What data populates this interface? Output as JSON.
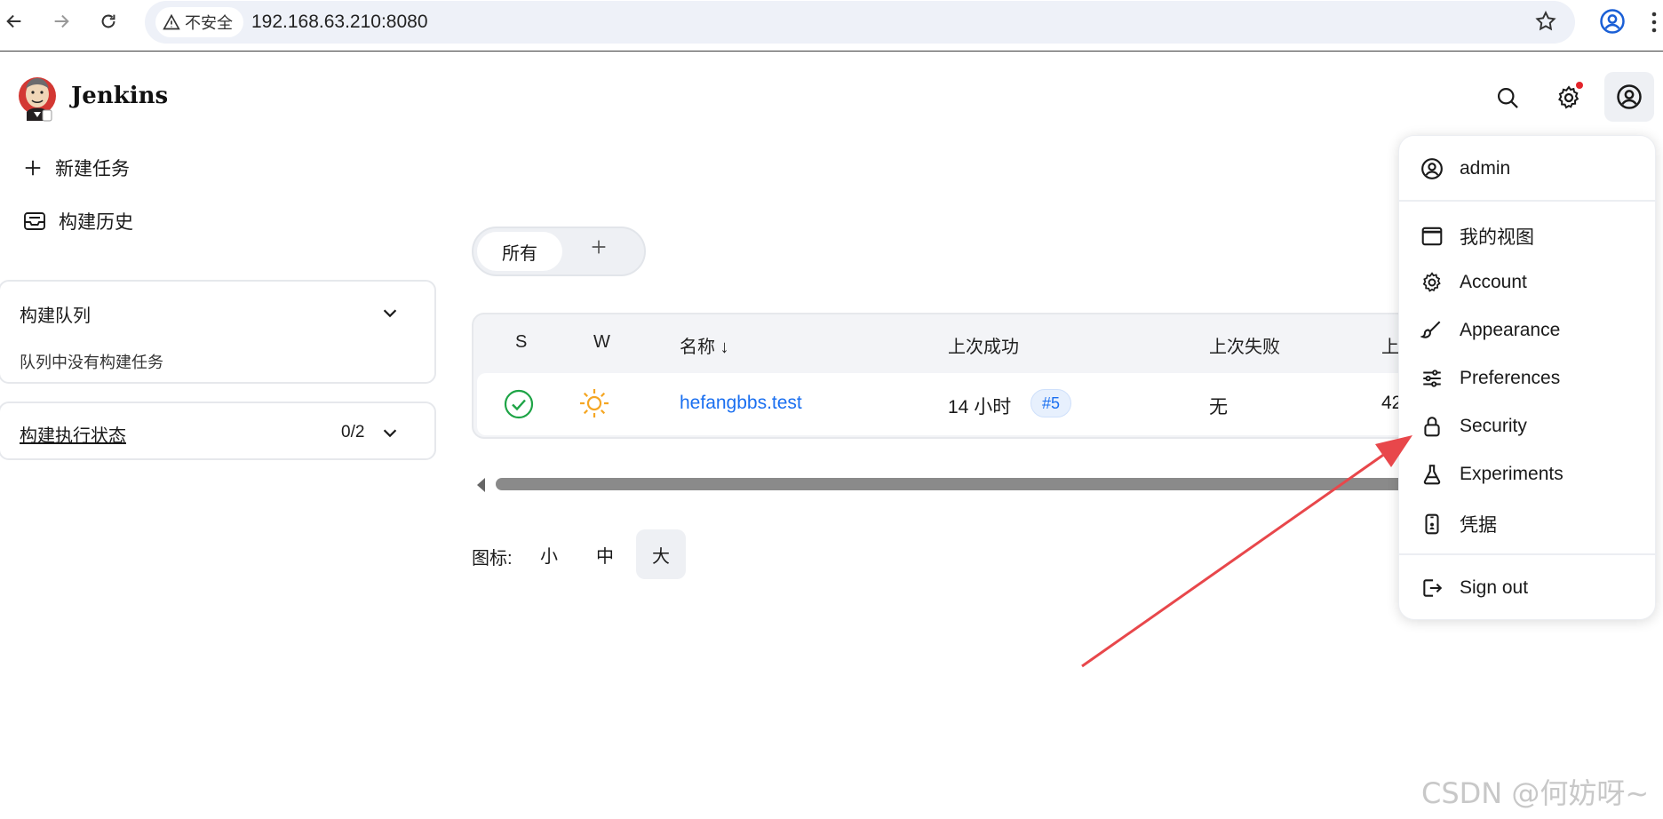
{
  "browser": {
    "insecure_label": "不安全",
    "url": "192.168.63.210:8080"
  },
  "header": {
    "brand": "Jenkins"
  },
  "sidebar": {
    "new_item": "新建任务",
    "build_history": "构建历史",
    "queue": {
      "title": "构建队列",
      "empty": "队列中没有构建任务"
    },
    "executors": {
      "title": "构建执行状态",
      "count": "0/2"
    }
  },
  "views": {
    "tabs": [
      "所有"
    ],
    "add_symbol": "+"
  },
  "table": {
    "headers": {
      "s": "S",
      "w": "W",
      "name": "名称 ↓",
      "last_success": "上次成功",
      "last_failure": "上次失败",
      "last_duration": "上"
    },
    "rows": [
      {
        "status": "success",
        "weather": "sunny",
        "name": "hefangbbs.test",
        "last_success": "14 小时",
        "build": "#5",
        "last_failure": "无",
        "last_duration": "42"
      }
    ]
  },
  "icon_size": {
    "label": "图标:",
    "options": [
      "小",
      "中",
      "大"
    ],
    "selected": "大"
  },
  "user_menu": {
    "username": "admin",
    "items": [
      {
        "label": "我的视图",
        "icon": "window-icon"
      },
      {
        "label": "Account",
        "icon": "gear-icon"
      },
      {
        "label": "Appearance",
        "icon": "brush-icon"
      },
      {
        "label": "Preferences",
        "icon": "sliders-icon"
      },
      {
        "label": "Security",
        "icon": "lock-icon"
      },
      {
        "label": "Experiments",
        "icon": "flask-icon"
      },
      {
        "label": "凭据",
        "icon": "phone-badge-icon"
      }
    ],
    "sign_out": "Sign out"
  },
  "watermark": "CSDN @何妨呀~",
  "colors": {
    "link": "#1a6ff0",
    "success": "#1ea446",
    "sun": "#f5a623",
    "arrow": "#e8474b"
  }
}
